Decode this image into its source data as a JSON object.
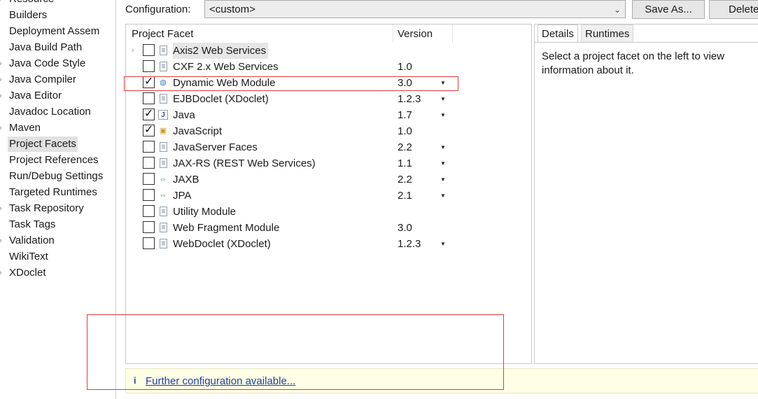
{
  "left_tree": {
    "items": [
      {
        "label": "Resource",
        "expandable": true,
        "selected": false
      },
      {
        "label": "Builders",
        "expandable": false,
        "selected": false
      },
      {
        "label": "Deployment Assem",
        "expandable": false,
        "selected": false
      },
      {
        "label": "Java Build Path",
        "expandable": false,
        "selected": false
      },
      {
        "label": "Java Code Style",
        "expandable": true,
        "selected": false
      },
      {
        "label": "Java Compiler",
        "expandable": true,
        "selected": false
      },
      {
        "label": "Java Editor",
        "expandable": true,
        "selected": false
      },
      {
        "label": "Javadoc Location",
        "expandable": false,
        "selected": false
      },
      {
        "label": "Maven",
        "expandable": true,
        "selected": false
      },
      {
        "label": "Project Facets",
        "expandable": false,
        "selected": true
      },
      {
        "label": "Project References",
        "expandable": false,
        "selected": false
      },
      {
        "label": "Run/Debug Settings",
        "expandable": false,
        "selected": false
      },
      {
        "label": "Targeted Runtimes",
        "expandable": false,
        "selected": false
      },
      {
        "label": "Task Repository",
        "expandable": true,
        "selected": false
      },
      {
        "label": "Task Tags",
        "expandable": false,
        "selected": false
      },
      {
        "label": "Validation",
        "expandable": true,
        "selected": false
      },
      {
        "label": "WikiText",
        "expandable": false,
        "selected": false
      },
      {
        "label": "XDoclet",
        "expandable": true,
        "selected": false
      }
    ]
  },
  "configuration": {
    "label": "Configuration:",
    "value": "<custom>",
    "save_as_label": "Save As...",
    "delete_label": "Delete"
  },
  "facets_table": {
    "col_facet": "Project Facet",
    "col_version": "Version",
    "rows": [
      {
        "name": "Axis2 Web Services",
        "version": "",
        "checked": false,
        "dropdown": false,
        "expandable": true,
        "icon": "page-icon",
        "highlight": true
      },
      {
        "name": "CXF 2.x Web Services",
        "version": "1.0",
        "checked": false,
        "dropdown": false,
        "expandable": false,
        "icon": "page-icon",
        "highlight": false
      },
      {
        "name": "Dynamic Web Module",
        "version": "3.0",
        "checked": true,
        "dropdown": true,
        "expandable": false,
        "icon": "globe-icon",
        "highlight": false
      },
      {
        "name": "EJBDoclet (XDoclet)",
        "version": "1.2.3",
        "checked": false,
        "dropdown": true,
        "expandable": false,
        "icon": "page-icon",
        "highlight": false
      },
      {
        "name": "Java",
        "version": "1.7",
        "checked": true,
        "dropdown": true,
        "expandable": false,
        "icon": "java-file-icon",
        "highlight": false
      },
      {
        "name": "JavaScript",
        "version": "1.0",
        "checked": true,
        "dropdown": false,
        "expandable": false,
        "icon": "javascript-icon",
        "highlight": false
      },
      {
        "name": "JavaServer Faces",
        "version": "2.2",
        "checked": false,
        "dropdown": true,
        "expandable": false,
        "icon": "page-icon",
        "highlight": false
      },
      {
        "name": "JAX-RS (REST Web Services)",
        "version": "1.1",
        "checked": false,
        "dropdown": true,
        "expandable": false,
        "icon": "page-icon",
        "highlight": false
      },
      {
        "name": "JAXB",
        "version": "2.2",
        "checked": false,
        "dropdown": true,
        "expandable": false,
        "icon": "arrows-icon",
        "highlight": false
      },
      {
        "name": "JPA",
        "version": "2.1",
        "checked": false,
        "dropdown": true,
        "expandable": false,
        "icon": "arrows-icon",
        "highlight": false
      },
      {
        "name": "Utility Module",
        "version": "",
        "checked": false,
        "dropdown": false,
        "expandable": false,
        "icon": "page-icon",
        "highlight": false
      },
      {
        "name": "Web Fragment Module",
        "version": "3.0",
        "checked": false,
        "dropdown": false,
        "expandable": false,
        "icon": "page-icon",
        "highlight": false
      },
      {
        "name": "WebDoclet (XDoclet)",
        "version": "1.2.3",
        "checked": false,
        "dropdown": true,
        "expandable": false,
        "icon": "page-icon",
        "highlight": false
      }
    ]
  },
  "details": {
    "tab_details": "Details",
    "tab_runtimes": "Runtimes",
    "text": "Select a project facet on the left to view information about it."
  },
  "info_bar": {
    "icon": "info-icon",
    "link_text": "Further configuration available..."
  },
  "colors": {
    "annotation": "#e53a3a",
    "link": "#1a3fa8",
    "info_bg": "#ffffe6",
    "selection": "#e1e1e1"
  }
}
